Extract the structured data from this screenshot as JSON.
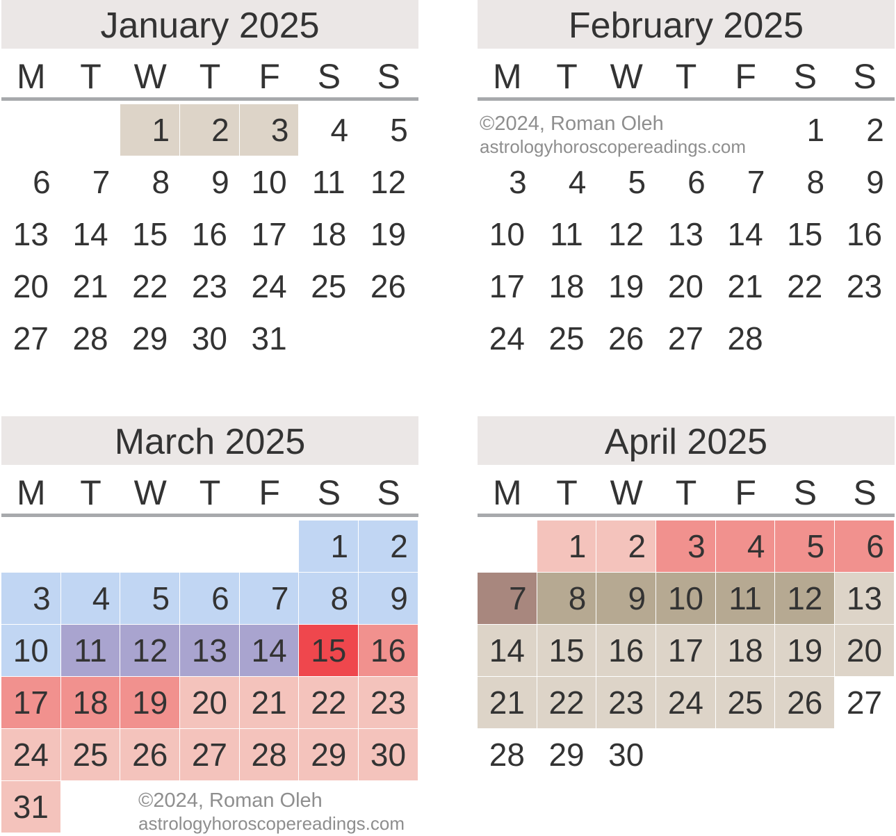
{
  "months": [
    {
      "title": "January 2025",
      "offset": 2,
      "days": 31,
      "colors": {
        "1": "#ddd4c8",
        "2": "#ddd4c8",
        "3": "#ddd4c8"
      }
    },
    {
      "title": "February 2025",
      "offset": 5,
      "days": 28,
      "colors": {}
    },
    {
      "title": "March 2025",
      "offset": 5,
      "days": 31,
      "colors": {
        "1": "#c1d6f3",
        "2": "#c1d6f3",
        "3": "#c1d6f3",
        "4": "#c1d6f3",
        "5": "#c1d6f3",
        "6": "#c1d6f3",
        "7": "#c1d6f3",
        "8": "#c1d6f3",
        "9": "#c1d6f3",
        "10": "#c1d6f3",
        "11": "#a9a4cf",
        "12": "#a9a4cf",
        "13": "#a9a4cf",
        "14": "#a9a4cf",
        "15": "#ef474d",
        "16": "#f1918e",
        "17": "#f1918e",
        "18": "#f1918e",
        "19": "#f1918e",
        "20": "#f4c3bc",
        "21": "#f4c3bc",
        "22": "#f4c3bc",
        "23": "#f4c3bc",
        "24": "#f4c3bc",
        "25": "#f4c3bc",
        "26": "#f4c3bc",
        "27": "#f4c3bc",
        "28": "#f4c3bc",
        "29": "#f4c3bc",
        "30": "#f4c3bc",
        "31": "#f4c3bc"
      }
    },
    {
      "title": "April 2025",
      "offset": 1,
      "days": 30,
      "colors": {
        "1": "#f4c3bc",
        "2": "#f4c3bc",
        "3": "#f1918e",
        "4": "#f1918e",
        "5": "#f1918e",
        "6": "#f1918e",
        "7": "#a8877e",
        "8": "#b6a992",
        "9": "#b6a992",
        "10": "#b6a992",
        "11": "#b6a992",
        "12": "#b6a992",
        "13": "#ddd4c8",
        "14": "#ddd4c8",
        "15": "#ddd4c8",
        "16": "#ddd4c8",
        "17": "#ddd4c8",
        "18": "#ddd4c8",
        "19": "#ddd4c8",
        "20": "#ddd4c8",
        "21": "#ddd4c8",
        "22": "#ddd4c8",
        "23": "#ddd4c8",
        "24": "#ddd4c8",
        "25": "#ddd4c8",
        "26": "#ddd4c8"
      }
    }
  ],
  "weekdays": [
    "M",
    "T",
    "W",
    "T",
    "F",
    "S",
    "S"
  ],
  "watermark": {
    "copyright": "©2024, Roman Oleh",
    "site": "astrologyhoroscopereadings.com"
  }
}
